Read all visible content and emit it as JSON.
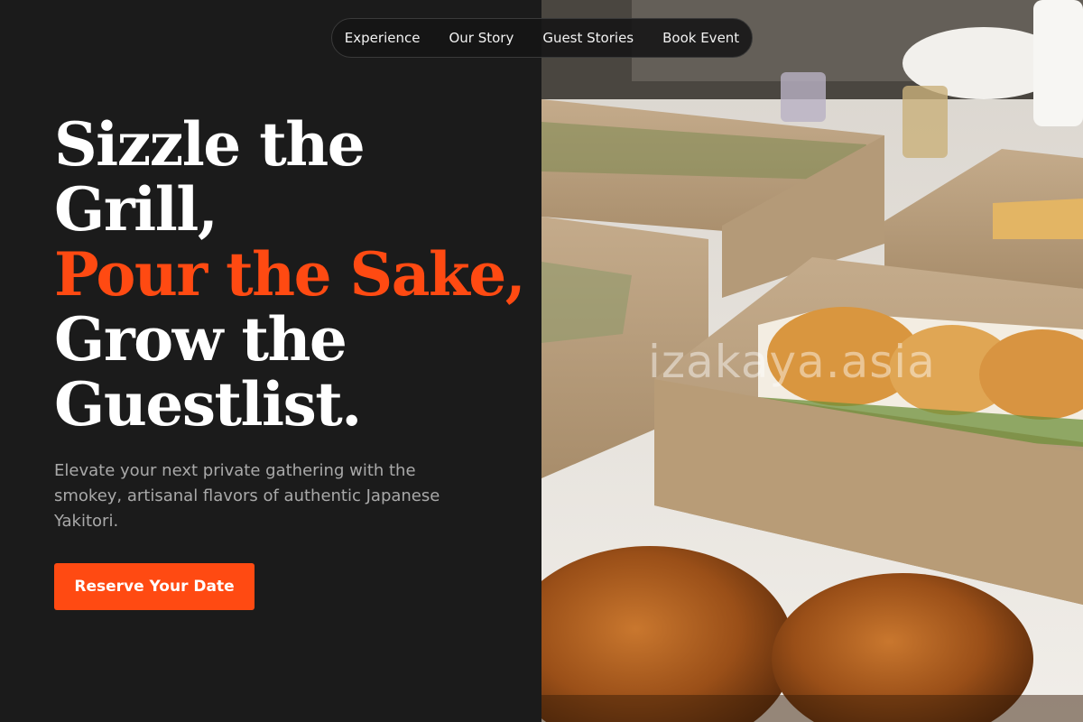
{
  "nav": {
    "items": [
      "Experience",
      "Our Story",
      "Guest Stories",
      "Book Event"
    ]
  },
  "hero": {
    "headline_lines": [
      "Sizzle the",
      "Grill,",
      "Pour the Sake,",
      "Grow the",
      "Guestlist."
    ],
    "description": "Elevate your next private gathering with the smokey, artisanal flavors of authentic Japanese Yakitori.",
    "cta_label": "Reserve Your Date"
  },
  "image": {
    "watermark": "izakaya.asia"
  },
  "colors": {
    "accent": "#ff4a12",
    "background": "#1b1b1b",
    "headline": "#ffffff",
    "body_text": "#a9a9a9"
  }
}
